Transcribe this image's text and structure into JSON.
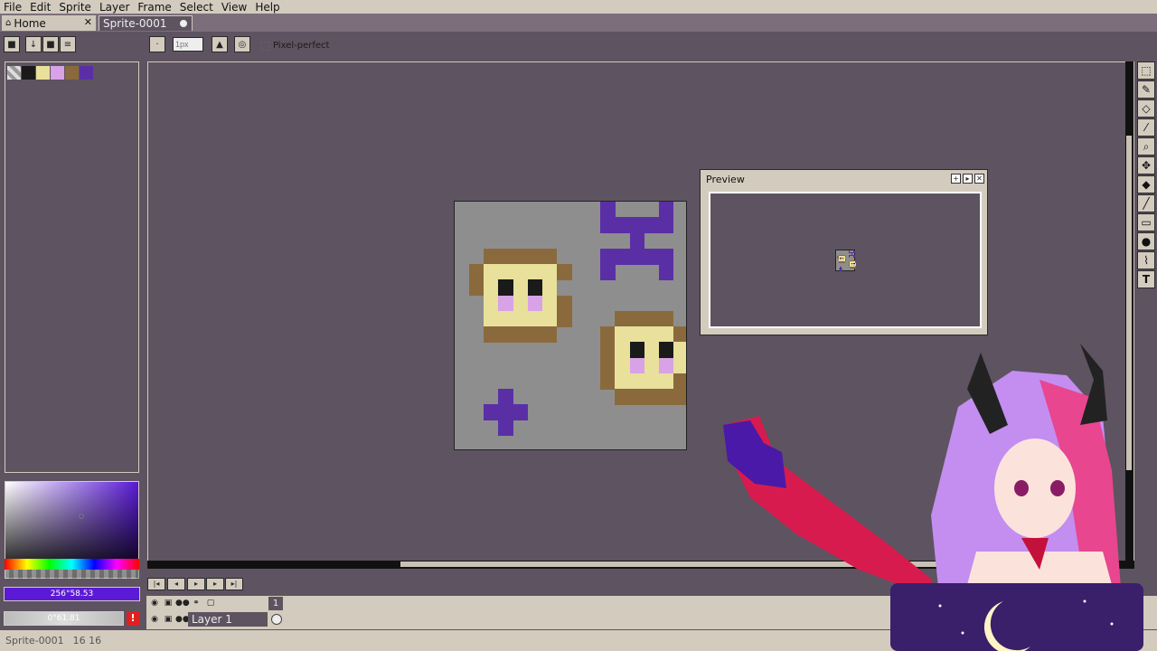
{
  "menu": [
    "File",
    "Edit",
    "Sprite",
    "Layer",
    "Frame",
    "Select",
    "View",
    "Help"
  ],
  "tabs": {
    "home": {
      "label": "Home",
      "close": "✕"
    },
    "sprite": {
      "label": "Sprite-0001"
    }
  },
  "toolbar": {
    "brush_size_placeholder": "1px",
    "pixel_perfect_label": "Pixel-perfect"
  },
  "palette": [
    "#bdbdbd",
    "#1a1a1a",
    "#e8e09b",
    "#d7a2e6",
    "#8a6a3c",
    "#5a2fa6"
  ],
  "color_bars": {
    "foreground": "256°58.53",
    "background": "0°61.81"
  },
  "preview": {
    "title": "Preview"
  },
  "timeline": {
    "frame_number": "1",
    "layer_name": "Layer 1"
  },
  "status": {
    "sprite_name": "Sprite-0001",
    "dimensions": "16 16"
  },
  "colors": {
    "bread_crust": "#8a6a3c",
    "bread_face": "#e8e09b",
    "eyes": "#1a1a1a",
    "blush": "#d7a2e6",
    "sparkle": "#5a2fa6",
    "canvas_bg": "#8e8e8e"
  }
}
